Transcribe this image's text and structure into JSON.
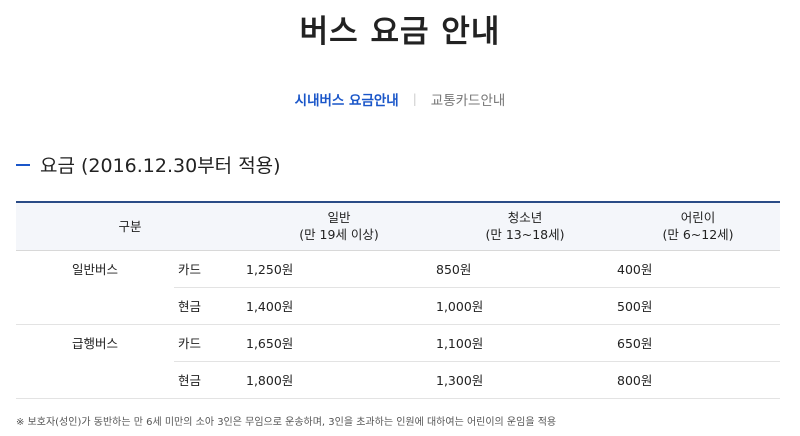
{
  "page": {
    "title": "버스 요금 안내"
  },
  "tabs": [
    {
      "label": "시내버스 요금안내",
      "active": true
    },
    {
      "label": "교통카드안내",
      "active": false
    }
  ],
  "tab_separator": "|",
  "section": {
    "heading": "요금 (2016.12.30부터 적용)"
  },
  "table": {
    "headers": {
      "category": "구분",
      "adult": "일반",
      "adult_sub": "(만 19세 이상)",
      "youth": "청소년",
      "youth_sub": "(만 13~18세)",
      "child": "어린이",
      "child_sub": "(만 6~12세)"
    },
    "rows": [
      {
        "bus_type": "일반버스",
        "method": "카드",
        "adult": "1,250원",
        "youth": "850원",
        "child": "400원"
      },
      {
        "bus_type": "",
        "method": "현금",
        "adult": "1,400원",
        "youth": "1,000원",
        "child": "500원"
      },
      {
        "bus_type": "급행버스",
        "method": "카드",
        "adult": "1,650원",
        "youth": "1,100원",
        "child": "650원"
      },
      {
        "bus_type": "",
        "method": "현금",
        "adult": "1,800원",
        "youth": "1,300원",
        "child": "800원"
      }
    ]
  },
  "footnote": "※ 보호자(성인)가 동반하는 만 6세 미만의 소아 3인은 무임으로 운송하며, 3인을 초과하는 인원에 대하여는 어린이의 운임을 적용",
  "colors": {
    "accent": "#1a56c9",
    "table_top_border": "#2a4b86",
    "header_bg": "#f4f6fa"
  }
}
